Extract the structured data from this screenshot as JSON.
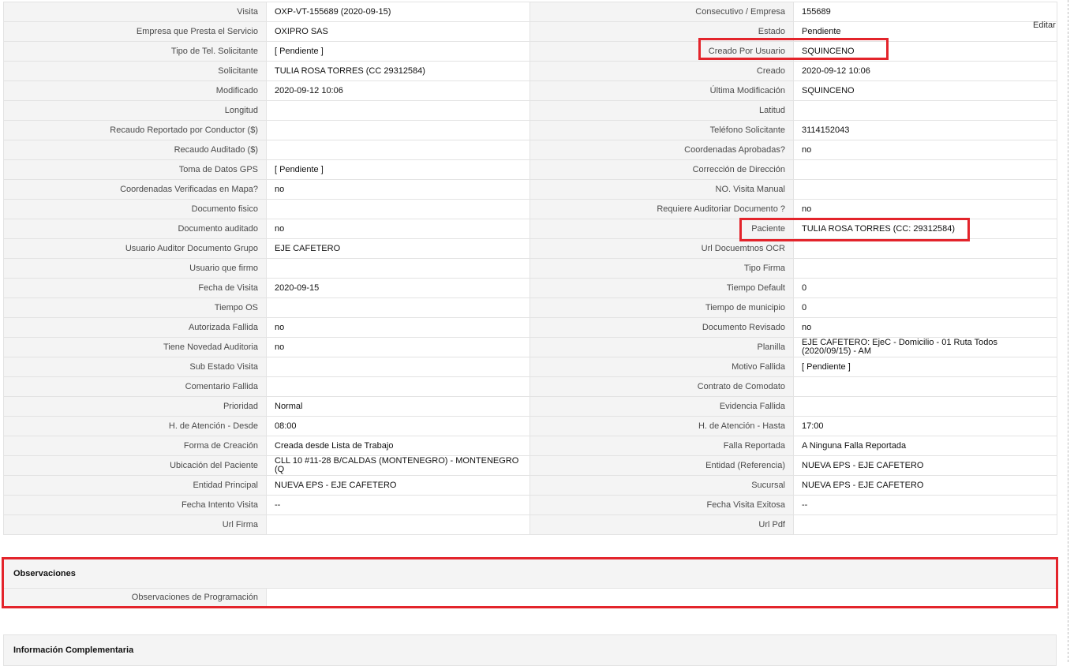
{
  "edit_label": "Editar",
  "rows": [
    [
      "Visita",
      "OXP-VT-155689 (2020-09-15)",
      "Consecutivo / Empresa",
      "155689"
    ],
    [
      "Empresa que Presta el Servicio",
      "OXIPRO SAS",
      "Estado",
      "Pendiente"
    ],
    [
      "Tipo de Tel. Solicitante",
      "[ Pendiente ]",
      "Creado Por Usuario",
      "SQUINCENO"
    ],
    [
      "Solicitante",
      "TULIA ROSA TORRES (CC 29312584)",
      "Creado",
      "2020-09-12 10:06"
    ],
    [
      "Modificado",
      "2020-09-12 10:06",
      "Última Modificación",
      " SQUINCENO"
    ],
    [
      "Longitud",
      "",
      "Latitud",
      ""
    ],
    [
      "Recaudo Reportado por Conductor ($)",
      "",
      "Teléfono Solicitante",
      "3114152043"
    ],
    [
      "Recaudo Auditado ($)",
      "",
      "Coordenadas Aprobadas?",
      " no"
    ],
    [
      "Toma de Datos GPS",
      "[ Pendiente ]",
      "Corrección de Dirección",
      ""
    ],
    [
      "Coordenadas Verificadas en Mapa?",
      " no",
      "NO. Visita Manual",
      ""
    ],
    [
      "Documento fisico",
      "",
      "Requiere Auditoriar Documento ?",
      " no"
    ],
    [
      "Documento auditado",
      " no",
      "Paciente",
      "TULIA ROSA TORRES (CC: 29312584)"
    ],
    [
      "Usuario Auditor Documento Grupo",
      "EJE CAFETERO",
      "Url Docuemtnos OCR",
      ""
    ],
    [
      "Usuario que firmo",
      "",
      "Tipo Firma",
      ""
    ],
    [
      "Fecha de Visita",
      " 2020-09-15",
      "Tiempo Default",
      "0"
    ],
    [
      "Tiempo OS",
      "",
      "Tiempo de municipio",
      "0"
    ],
    [
      "Autorizada Fallida",
      " no",
      "Documento Revisado",
      " no"
    ],
    [
      "Tiene Novedad Auditoria",
      " no",
      "Planilla",
      "EJE CAFETERO: EjeC - Domicilio - 01 Ruta Todos (2020/09/15) - AM"
    ],
    [
      "Sub Estado Visita",
      "",
      "Motivo Fallida",
      "[ Pendiente ]"
    ],
    [
      "Comentario Fallida",
      "",
      "Contrato de Comodato",
      ""
    ],
    [
      "Prioridad",
      "Normal",
      "Evidencia Fallida",
      ""
    ],
    [
      "H. de Atención - Desde",
      "08:00",
      "H. de Atención - Hasta",
      "17:00"
    ],
    [
      "Forma de Creación",
      "Creada desde Lista de Trabajo",
      "Falla Reportada",
      "A Ninguna Falla Reportada"
    ],
    [
      "Ubicación del Paciente",
      "CLL 10 #11-28 B/CALDAS (MONTENEGRO) - MONTENEGRO (Q",
      "Entidad (Referencia)",
      "NUEVA EPS - EJE CAFETERO"
    ],
    [
      "Entidad Principal",
      "NUEVA EPS - EJE CAFETERO",
      "Sucursal",
      "NUEVA EPS - EJE CAFETERO"
    ],
    [
      "Fecha Intento Visita",
      " --",
      "Fecha Visita Exitosa",
      " --"
    ],
    [
      "Url Firma",
      "",
      "Url Pdf",
      ""
    ]
  ],
  "observaciones": {
    "title": "Observaciones",
    "label": "Observaciones de Programación",
    "value": ""
  },
  "info_complementaria": {
    "title": "Información Complementaria"
  },
  "colors": {
    "highlight": "#e3242b",
    "label_bg": "#f4f4f4",
    "border": "#e3e3e3"
  }
}
